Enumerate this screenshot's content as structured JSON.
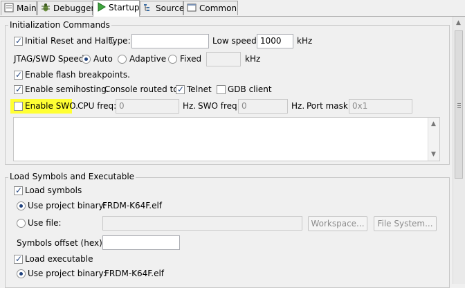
{
  "tabs": [
    {
      "label": "Main",
      "icon": "main-icon"
    },
    {
      "label": "Debugger",
      "icon": "debugger-icon"
    },
    {
      "label": "Startup",
      "icon": "startup-icon",
      "active": true
    },
    {
      "label": "Source",
      "icon": "source-icon"
    },
    {
      "label": "Common",
      "icon": "common-icon"
    }
  ],
  "init": {
    "title": "Initialization Commands",
    "initial_reset_label": "Initial Reset and Halt.",
    "type_label": "Type:",
    "type_value": "",
    "low_speed_label": "Low speed:",
    "low_speed_value": "1000",
    "low_speed_unit": "kHz",
    "jtag_label": "JTAG/SWD Speed:",
    "auto_label": "Auto",
    "adaptive_label": "Adaptive",
    "fixed_label": "Fixed",
    "fixed_value": "",
    "fixed_unit": "kHz",
    "flash_bp_label": "Enable flash breakpoints.",
    "semihost_label": "Enable semihosting.",
    "console_label": "Console routed to:",
    "telnet_label": "Telnet",
    "gdb_client_label": "GDB client",
    "swo_label": "Enable SWO.",
    "cpu_freq_label": "CPU freq:",
    "cpu_freq_value": "0",
    "hz1": "Hz.",
    "swo_freq_label": "SWO freq:",
    "swo_freq_value": "0",
    "hz2": "Hz.",
    "port_mask_label": "Port mask:",
    "port_mask_value": "0x1"
  },
  "load": {
    "title": "Load Symbols and Executable",
    "load_symbols_label": "Load symbols",
    "use_project_binary_label": "Use project binary:",
    "project_binary_value": "FRDM-K64F.elf",
    "use_file_label": "Use file:",
    "use_file_value": "",
    "workspace_button": "Workspace...",
    "filesystem_button": "File System...",
    "symbols_offset_label": "Symbols offset (hex):",
    "symbols_offset_value": "",
    "load_executable_label": "Load executable",
    "use_project_binary2_label": "Use project binary:",
    "project_binary2_value": "FRDM-K64F.elf"
  },
  "colors": {
    "highlight": "#ffff33",
    "check": "#21437e"
  }
}
